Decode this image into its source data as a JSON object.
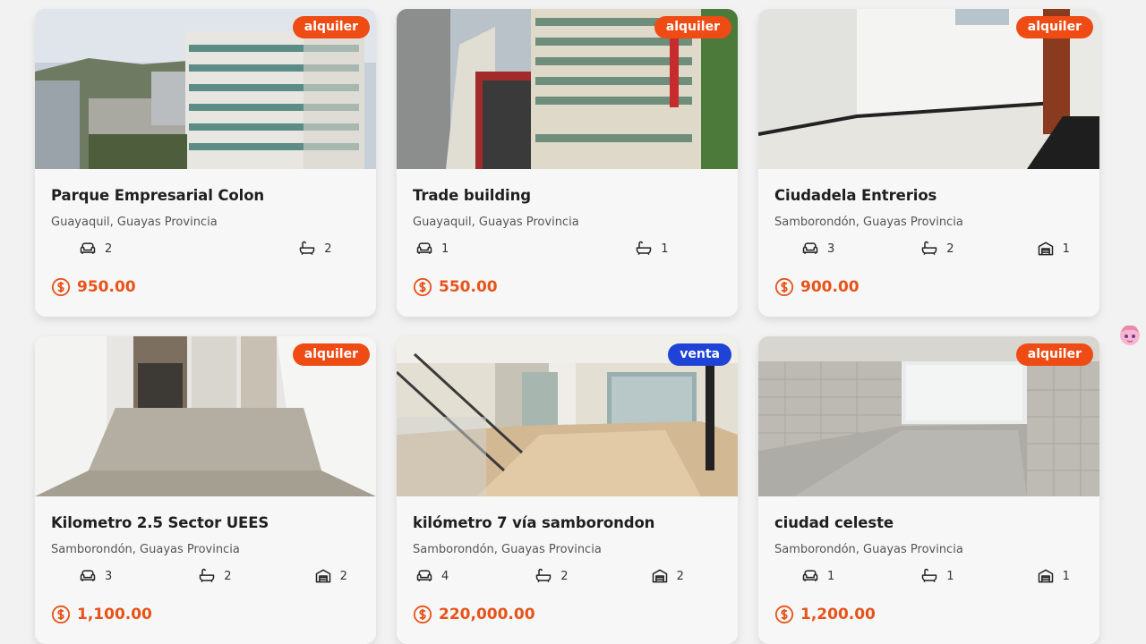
{
  "listings": [
    {
      "title": "Parque Empresarial Colon",
      "location": "Guayaquil, Guayas Provincia",
      "badge": "alquiler",
      "badge_color": "#ef4b14",
      "bedrooms": "2",
      "bathrooms": "2",
      "parking": null,
      "price": "950.00",
      "photo": "office-towers"
    },
    {
      "title": "Trade building",
      "location": "Guayaquil, Guayas Provincia",
      "badge": "alquiler",
      "badge_color": "#ef4b14",
      "bedrooms": "1",
      "bathrooms": "1",
      "parking": null,
      "price": "550.00",
      "photo": "office-building"
    },
    {
      "title": "Ciudadela Entrerios",
      "location": "Samborondón, Guayas Provincia",
      "badge": "alquiler",
      "badge_color": "#ef4b14",
      "bedrooms": "3",
      "bathrooms": "2",
      "parking": "1",
      "price": "900.00",
      "photo": "white-room"
    },
    {
      "title": "Kilometro 2.5 Sector UEES",
      "location": "Samborondón, Guayas Provincia",
      "badge": "alquiler",
      "badge_color": "#ef4b14",
      "bedrooms": "3",
      "bathrooms": "2",
      "parking": "2",
      "price": "1,100.00",
      "photo": "apartment-interior"
    },
    {
      "title": "kilómetro 7 vía samborondon",
      "location": "Samborondón, Guayas Provincia",
      "badge": "venta",
      "badge_color": "#1e43d6",
      "bedrooms": "4",
      "bathrooms": "2",
      "parking": "2",
      "price": "220,000.00",
      "photo": "marble-hall"
    },
    {
      "title": "ciudad celeste",
      "location": "Samborondón, Guayas Provincia",
      "badge": "alquiler",
      "badge_color": "#ef4b14",
      "bedrooms": "1",
      "bathrooms": "1",
      "parking": "1",
      "price": "1,200.00",
      "photo": "stone-wall-room"
    }
  ],
  "icons": {
    "bedrooms": "sofa-icon",
    "bathrooms": "bathtub-icon",
    "parking": "garage-icon",
    "price": "dollar-coin-icon"
  },
  "accent_color": "#e8531a"
}
